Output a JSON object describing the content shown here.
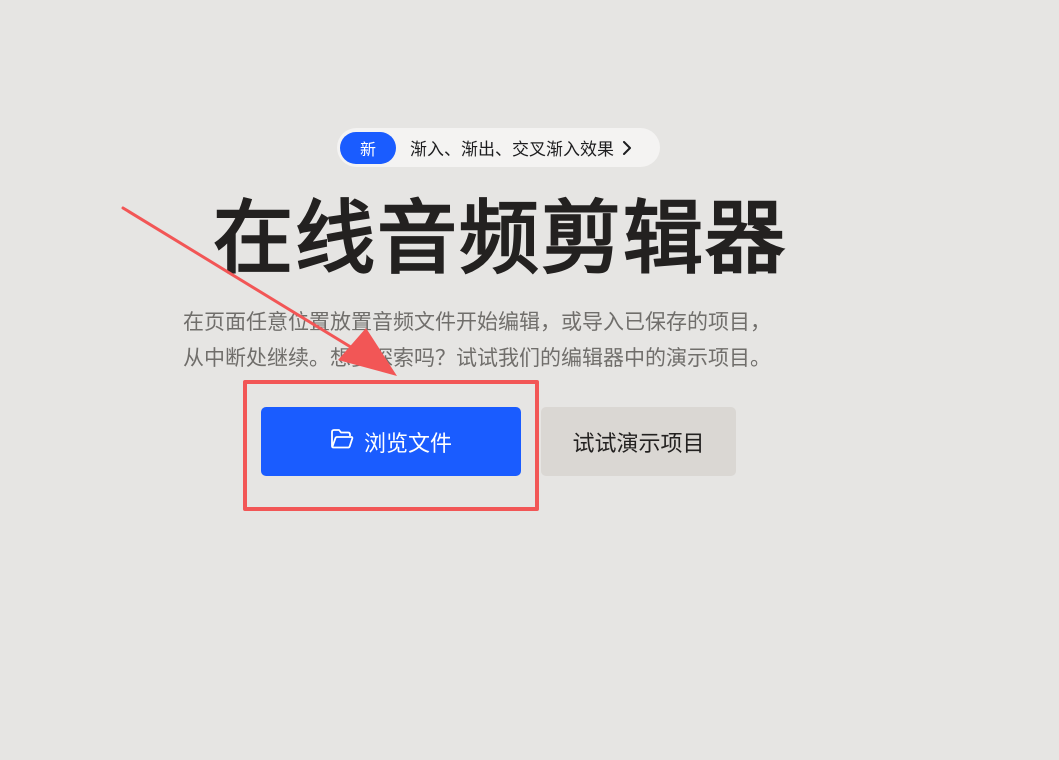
{
  "announcement": {
    "badge": "新",
    "text": "渐入、渐出、交叉渐入效果",
    "chevron_icon": "chevron-right-icon"
  },
  "hero": {
    "title": "在线音频剪辑器",
    "description_line1": "在页面任意位置放置音频文件开始编辑，或导入已保存的项目，",
    "description_line2": "从中断处继续。想要探索吗？试试我们的编辑器中的演示项目。"
  },
  "actions": {
    "browse_label": "浏览文件",
    "browse_icon": "folder-open-icon",
    "demo_label": "试试演示项目"
  },
  "colors": {
    "background": "#e6e5e3",
    "accent": "#1a5cff",
    "annotation": "#f25656",
    "secondary_button": "#dad7d3"
  }
}
